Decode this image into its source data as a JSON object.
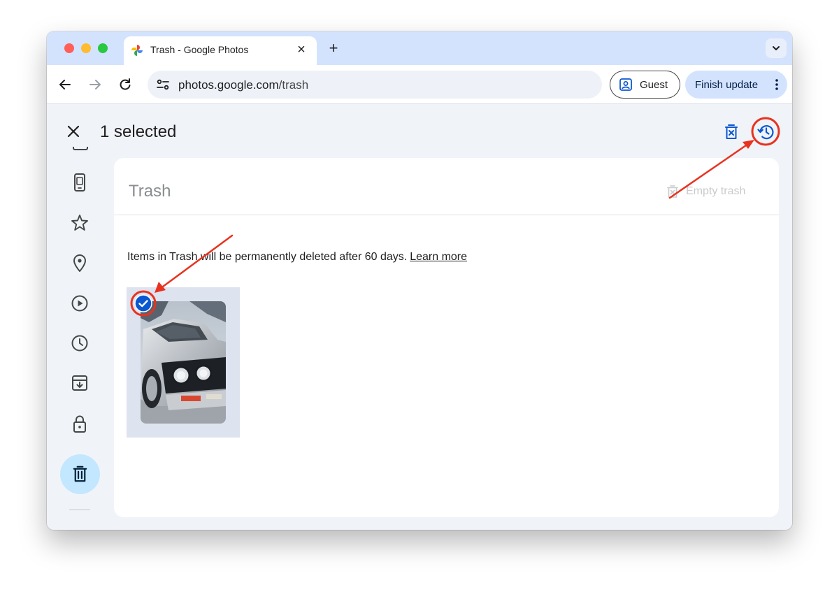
{
  "browser": {
    "tab_title": "Trash - Google Photos",
    "url_host": "photos.google.com",
    "url_path": "/trash",
    "profile_label": "Guest",
    "update_label": "Finish update"
  },
  "selection_bar": {
    "count_label": "1 selected"
  },
  "sidebar": {
    "items": [
      {
        "icon": "device-folders-icon"
      },
      {
        "icon": "star-icon"
      },
      {
        "icon": "location-pin-icon"
      },
      {
        "icon": "play-circle-icon"
      },
      {
        "icon": "clock-icon"
      },
      {
        "icon": "archive-icon"
      },
      {
        "icon": "lock-icon"
      },
      {
        "icon": "trash-icon",
        "active": true
      }
    ]
  },
  "trash": {
    "title": "Trash",
    "empty_label": "Empty trash",
    "notice": "Items in Trash will be permanently deleted after 60 days.",
    "learn_more": "Learn more"
  },
  "photos": [
    {
      "subject": "silver vintage car",
      "selected": true
    }
  ],
  "colors": {
    "accent": "#0b57d0",
    "annotation": "#e8321f",
    "active_nav": "#c2e7ff",
    "tabstrip": "#d3e3fd"
  }
}
